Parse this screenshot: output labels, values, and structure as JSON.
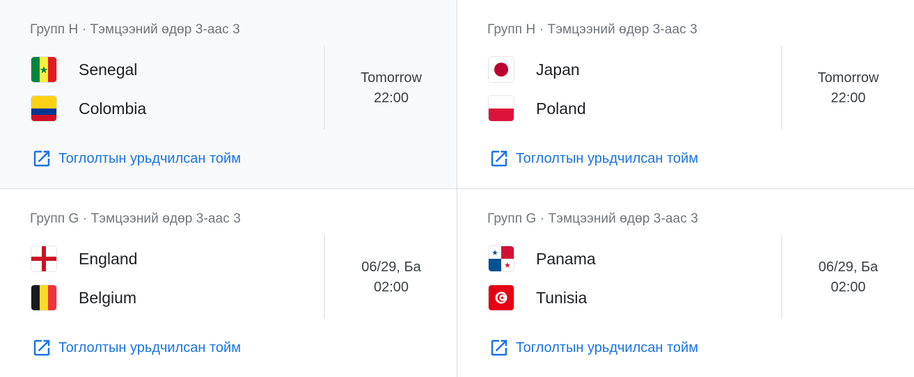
{
  "matches": [
    {
      "group": "Групп H · Тэмцээний өдөр 3-аас 3",
      "team1": {
        "name": "Senegal",
        "flag_icon": "senegal-flag-icon"
      },
      "team2": {
        "name": "Colombia",
        "flag_icon": "colombia-flag-icon"
      },
      "date": "Tomorrow",
      "time": "22:00",
      "preview_link": "Тоглолтын урьдчилсан тойм"
    },
    {
      "group": "Групп H · Тэмцээний өдөр 3-аас 3",
      "team1": {
        "name": "Japan",
        "flag_icon": "japan-flag-icon"
      },
      "team2": {
        "name": "Poland",
        "flag_icon": "poland-flag-icon"
      },
      "date": "Tomorrow",
      "time": "22:00",
      "preview_link": "Тоглолтын урьдчилсан тойм"
    },
    {
      "group": "Групп G · Тэмцээний өдөр 3-аас 3",
      "team1": {
        "name": "England",
        "flag_icon": "england-flag-icon"
      },
      "team2": {
        "name": "Belgium",
        "flag_icon": "belgium-flag-icon"
      },
      "date": "06/29, Ба",
      "time": "02:00",
      "preview_link": "Тоглолтын урьдчилсан тойм"
    },
    {
      "group": "Групп G · Тэмцээний өдөр 3-аас 3",
      "team1": {
        "name": "Panama",
        "flag_icon": "panama-flag-icon"
      },
      "team2": {
        "name": "Tunisia",
        "flag_icon": "tunisia-flag-icon"
      },
      "date": "06/29, Ба",
      "time": "02:00",
      "preview_link": "Тоглолтын урьдчилсан тойм"
    }
  ],
  "colors": {
    "link": "#1a73e8",
    "muted_text": "#70757a",
    "hover_background": "#f8f9fa",
    "divider": "#dadce0"
  }
}
